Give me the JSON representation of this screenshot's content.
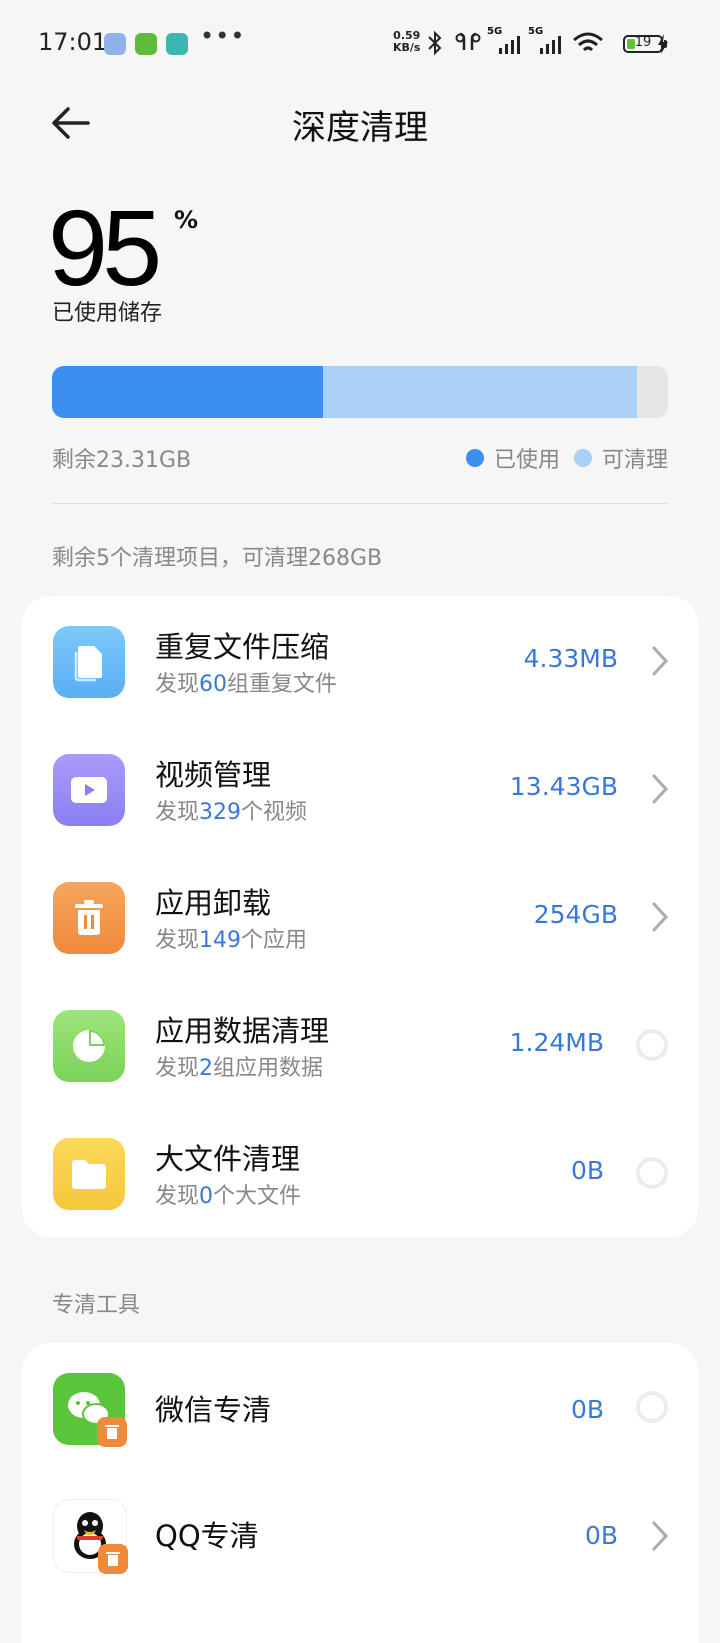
{
  "status_bar": {
    "time": "17:01",
    "net_speed_value": "0.59",
    "net_speed_unit": "KB/s",
    "signal_1_label": "5G",
    "signal_2_label": "5G",
    "battery_level": "19",
    "icons": [
      "app-notification-icon",
      "charging-app-icon",
      "chat-app-icon",
      "more-dots-icon",
      "bluetooth-icon",
      "earbuds-icon",
      "signal-icon",
      "wifi-icon",
      "battery-icon",
      "charging-bolt-icon"
    ]
  },
  "header": {
    "title": "深度清理",
    "back_icon": "arrow-left-icon"
  },
  "storage": {
    "used_percent": "95",
    "percent_symbol": "%",
    "used_label": "已使用储存",
    "used_fraction": 0.44,
    "cleanable_fraction": 0.51,
    "remaining_text": "剩余23.31GB",
    "legend_used": "已使用",
    "legend_cleanable": "可清理",
    "color_used": "#3b8ff0",
    "color_cleanable": "#a9d2f6"
  },
  "cleanup": {
    "summary": "剩余5个清理项目，可清理268GB",
    "items": [
      {
        "title": "重复文件压缩",
        "sub_prefix": "发现",
        "sub_count": "60",
        "sub_suffix": "组重复文件",
        "value": "4.33MB",
        "icon": "duplicate-files-icon",
        "state": "ready"
      },
      {
        "title": "视频管理",
        "sub_prefix": "发现",
        "sub_count": "329",
        "sub_suffix": "个视频",
        "value": "13.43GB",
        "icon": "video-camera-icon",
        "state": "ready"
      },
      {
        "title": "应用卸载",
        "sub_prefix": "发现",
        "sub_count": "149",
        "sub_suffix": "个应用",
        "value": "254GB",
        "icon": "trash-can-icon",
        "state": "ready"
      },
      {
        "title": "应用数据清理",
        "sub_prefix": "发现",
        "sub_count": "2",
        "sub_suffix": "组应用数据",
        "value": "1.24MB",
        "icon": "pie-chart-icon",
        "state": "loading"
      },
      {
        "title": "大文件清理",
        "sub_prefix": "发现",
        "sub_count": "0",
        "sub_suffix": "个大文件",
        "value": "0B",
        "icon": "folder-icon",
        "state": "loading"
      }
    ]
  },
  "tools": {
    "label": "专清工具",
    "items": [
      {
        "title": "微信专清",
        "value": "0B",
        "icon": "wechat-icon",
        "state": "loading"
      },
      {
        "title": "QQ专清",
        "value": "0B",
        "icon": "qq-penguin-icon",
        "state": "ready"
      }
    ]
  }
}
